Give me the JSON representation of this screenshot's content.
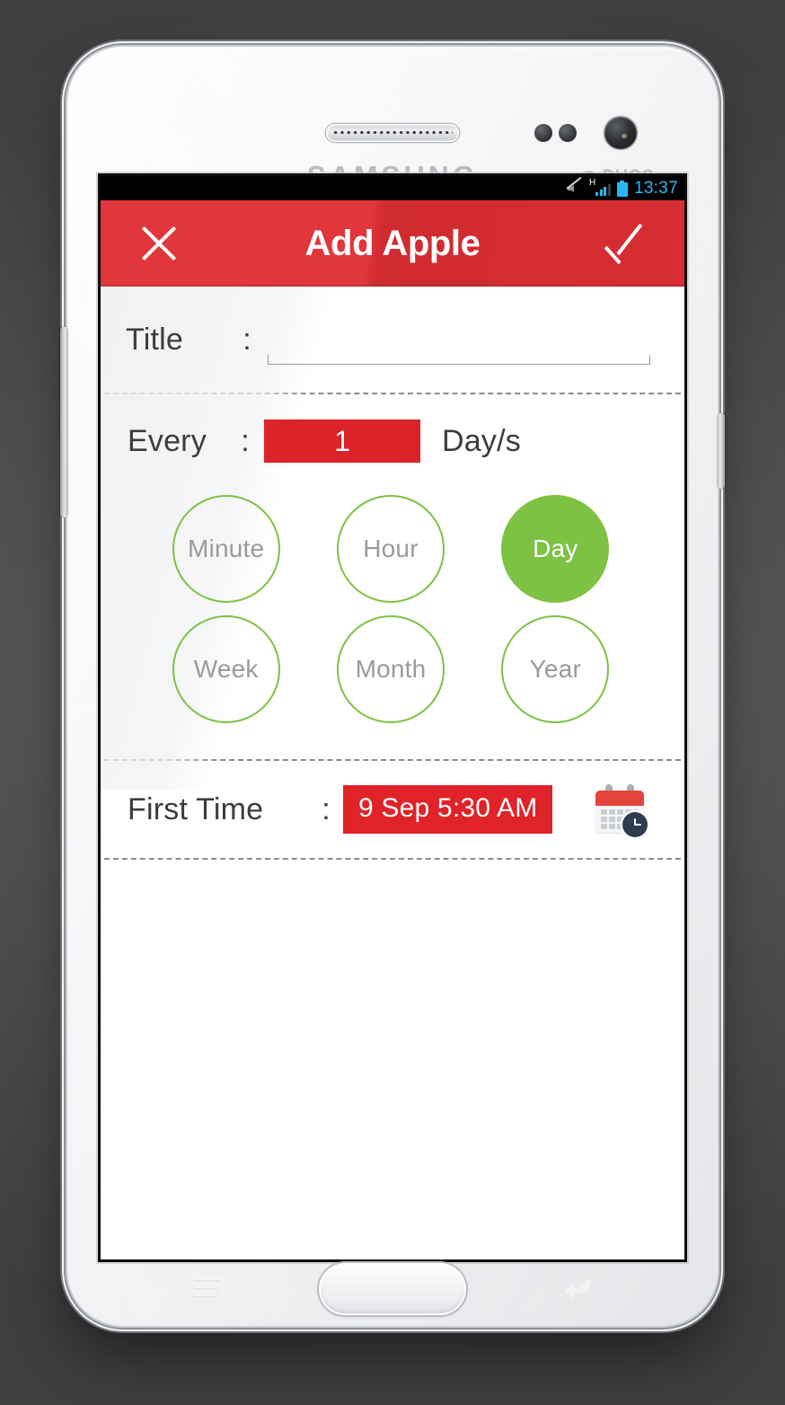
{
  "device": {
    "brand": "SAMSUNG",
    "variant": "DUOS",
    "earpiece_name": "earpiece-speaker",
    "camera_name": "front-camera-icon"
  },
  "status_bar": {
    "time": "13:37",
    "network_type": "H",
    "icons": [
      "mute-icon",
      "signal-bars-icon",
      "battery-icon"
    ]
  },
  "app_bar": {
    "title": "Add Apple",
    "close_icon": "close-icon",
    "confirm_icon": "check-icon"
  },
  "form": {
    "title_field": {
      "label": "Title",
      "separator": ":",
      "value": "",
      "placeholder": ""
    },
    "every_field": {
      "label": "Every",
      "separator": ":",
      "value": "1",
      "suffix": "Day/s"
    },
    "units": [
      {
        "label": "Minute",
        "selected": false
      },
      {
        "label": "Hour",
        "selected": false
      },
      {
        "label": "Day",
        "selected": true
      },
      {
        "label": "Week",
        "selected": false
      },
      {
        "label": "Month",
        "selected": false
      },
      {
        "label": "Year",
        "selected": false
      }
    ],
    "first_time_field": {
      "label": "First Time",
      "separator": ":",
      "value": "9 Sep 5:30 AM",
      "picker_icon": "calendar-clock-icon"
    }
  },
  "nav_keys": {
    "menu": "menu-key",
    "home": "home-button",
    "back": "back-key"
  },
  "colors": {
    "accent_red": "#DD2229",
    "app_bar_red": "#E0363C",
    "accent_green": "#7DC242",
    "status_blue": "#2FB8F0",
    "label_gray": "#3C3C3C",
    "unit_text_gray": "#9B9B9B",
    "backdrop": "#525252"
  }
}
